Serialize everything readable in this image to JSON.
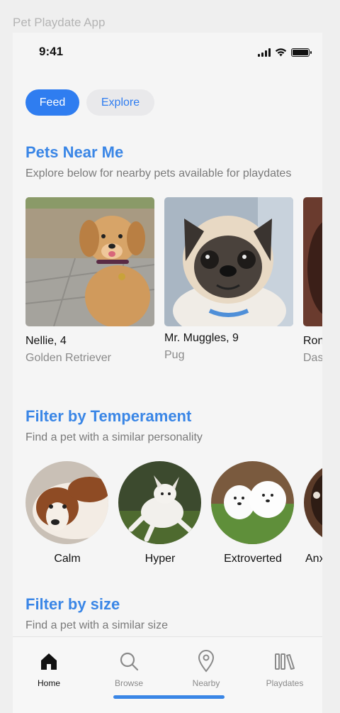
{
  "app_caption": "Pet Playdate App",
  "status": {
    "time": "9:41"
  },
  "toggle": {
    "feed": "Feed",
    "explore": "Explore"
  },
  "pets_section": {
    "title": "Pets Near Me",
    "subtitle": "Explore below for nearby pets available for playdates",
    "pets": [
      {
        "name": "Nellie, 4",
        "breed": "Golden Retriever"
      },
      {
        "name": "Mr. Muggles, 9",
        "breed": "Pug"
      },
      {
        "name": "Ron",
        "breed": "Das"
      }
    ]
  },
  "temperament_section": {
    "title": "Filter by Temperament",
    "subtitle": "Find a pet with a similar personality",
    "items": [
      {
        "label": "Calm"
      },
      {
        "label": "Hyper"
      },
      {
        "label": "Extroverted"
      },
      {
        "label": "Anx"
      }
    ]
  },
  "size_section": {
    "title": "Filter by size",
    "subtitle": "Find a pet with a similar size"
  },
  "nav": [
    {
      "label": "Home",
      "icon": "home-icon",
      "active": true
    },
    {
      "label": "Browse",
      "icon": "search-icon",
      "active": false
    },
    {
      "label": "Nearby",
      "icon": "location-pin-icon",
      "active": false
    },
    {
      "label": "Playdates",
      "icon": "library-icon",
      "active": false
    }
  ],
  "colors": {
    "accent": "#2f7df0",
    "title_blue": "#3a86e6"
  }
}
